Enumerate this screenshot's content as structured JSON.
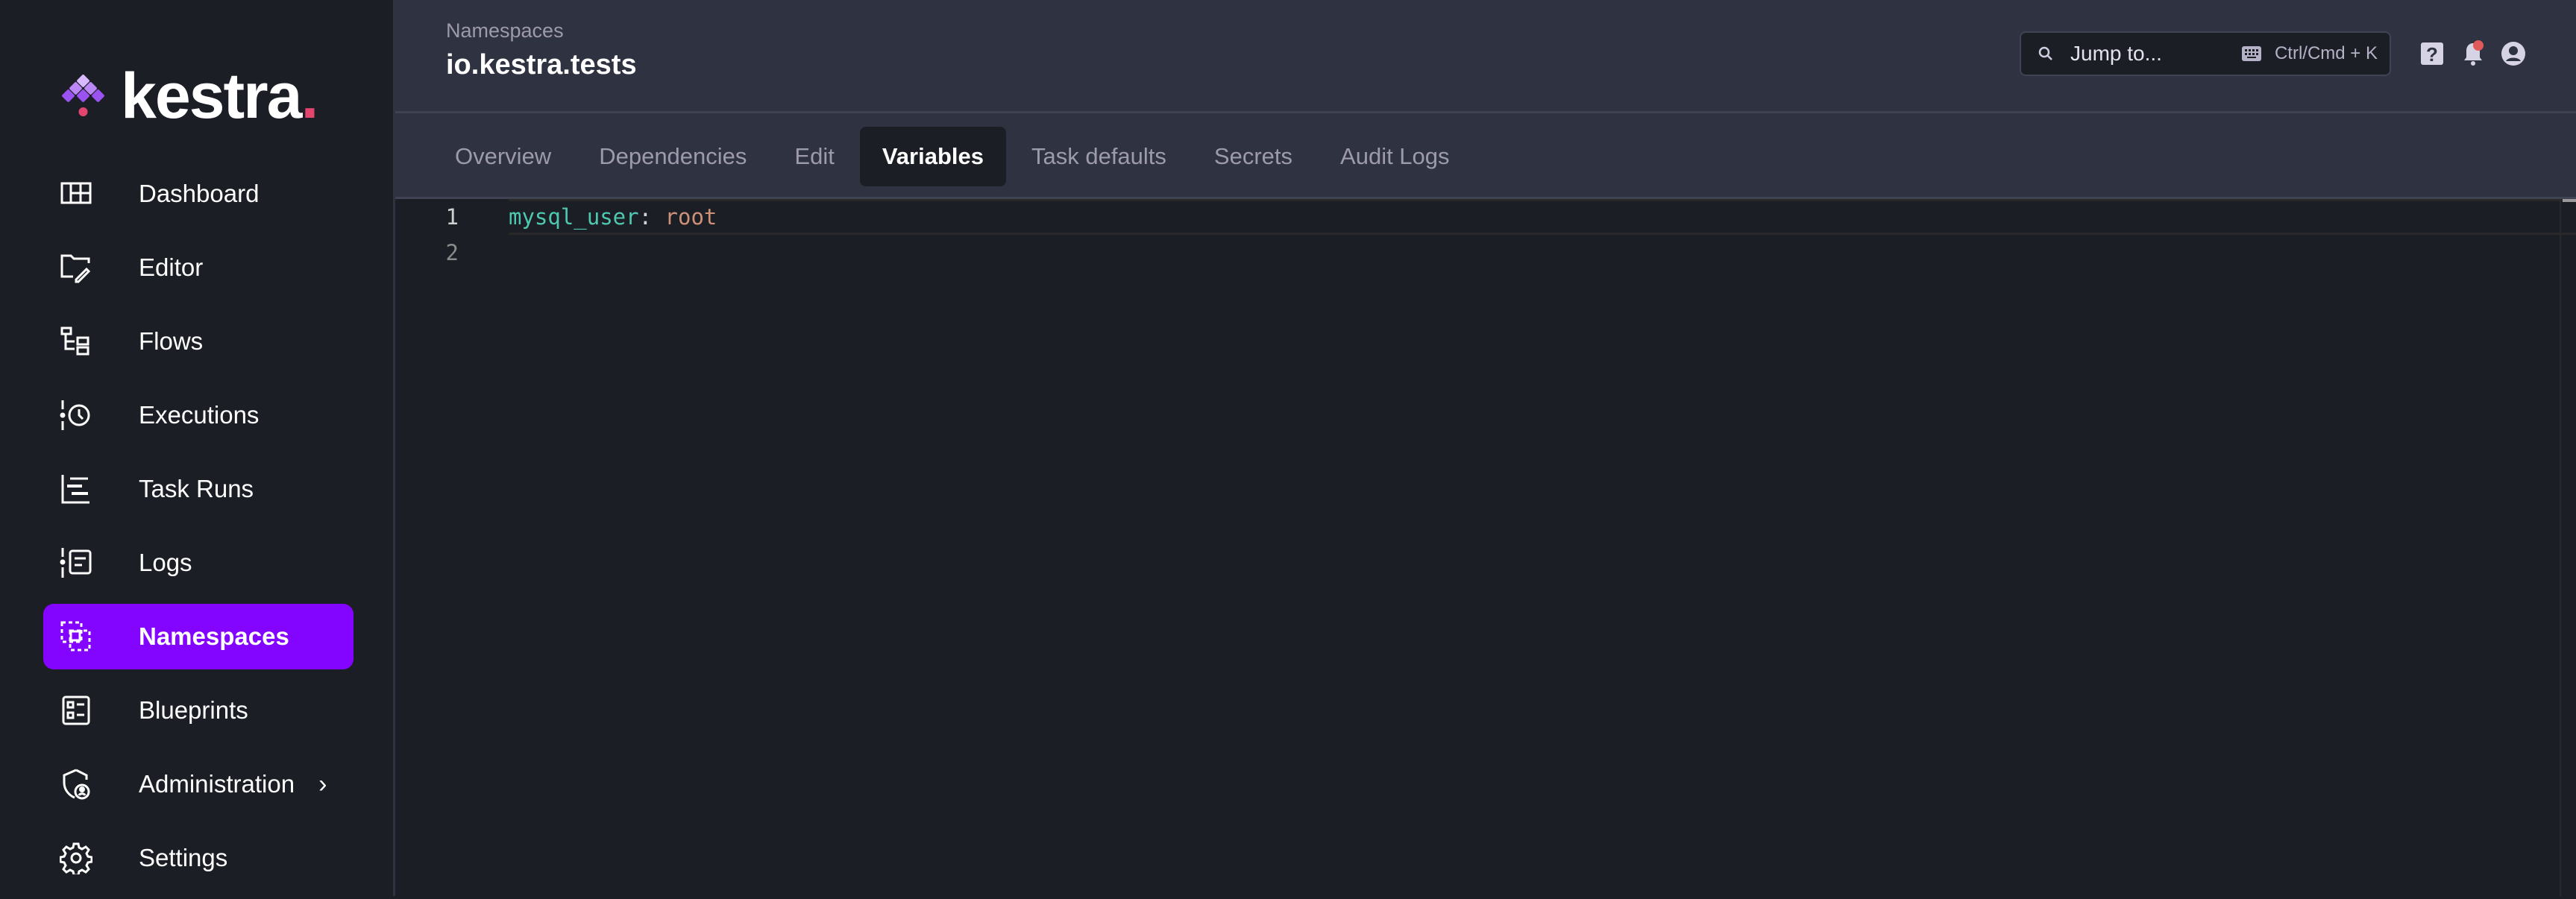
{
  "brand": {
    "name": "kestra",
    "dot": ".",
    "accent": "#8405ff",
    "dot_color": "#e2466f"
  },
  "sidebar": {
    "items": [
      {
        "label": "Dashboard",
        "icon": "dashboard-icon",
        "active": false
      },
      {
        "label": "Editor",
        "icon": "folder-edit-icon",
        "active": false
      },
      {
        "label": "Flows",
        "icon": "flows-icon",
        "active": false
      },
      {
        "label": "Executions",
        "icon": "executions-clock-icon",
        "active": false
      },
      {
        "label": "Task Runs",
        "icon": "task-runs-icon",
        "active": false
      },
      {
        "label": "Logs",
        "icon": "logs-icon",
        "active": false
      },
      {
        "label": "Namespaces",
        "icon": "namespaces-icon",
        "active": true
      },
      {
        "label": "Blueprints",
        "icon": "blueprints-icon",
        "active": false
      },
      {
        "label": "Administration",
        "icon": "admin-shield-icon",
        "active": false,
        "has_submenu": true
      },
      {
        "label": "Settings",
        "icon": "gear-icon",
        "active": false
      }
    ]
  },
  "header": {
    "breadcrumb": "Namespaces",
    "title": "io.kestra.tests",
    "search": {
      "placeholder": "Jump to...",
      "shortcut": "Ctrl/Cmd + K"
    },
    "notification_badge_color": "#e05a5a"
  },
  "tabs": [
    {
      "label": "Overview",
      "active": false
    },
    {
      "label": "Dependencies",
      "active": false
    },
    {
      "label": "Edit",
      "active": false
    },
    {
      "label": "Variables",
      "active": true
    },
    {
      "label": "Task defaults",
      "active": false
    },
    {
      "label": "Secrets",
      "active": false
    },
    {
      "label": "Audit Logs",
      "active": false
    }
  ],
  "editor": {
    "lines": [
      {
        "number": "1",
        "key": "mysql_user",
        "sep": ": ",
        "value": "root"
      },
      {
        "number": "2",
        "key": "",
        "sep": "",
        "value": ""
      }
    ]
  }
}
